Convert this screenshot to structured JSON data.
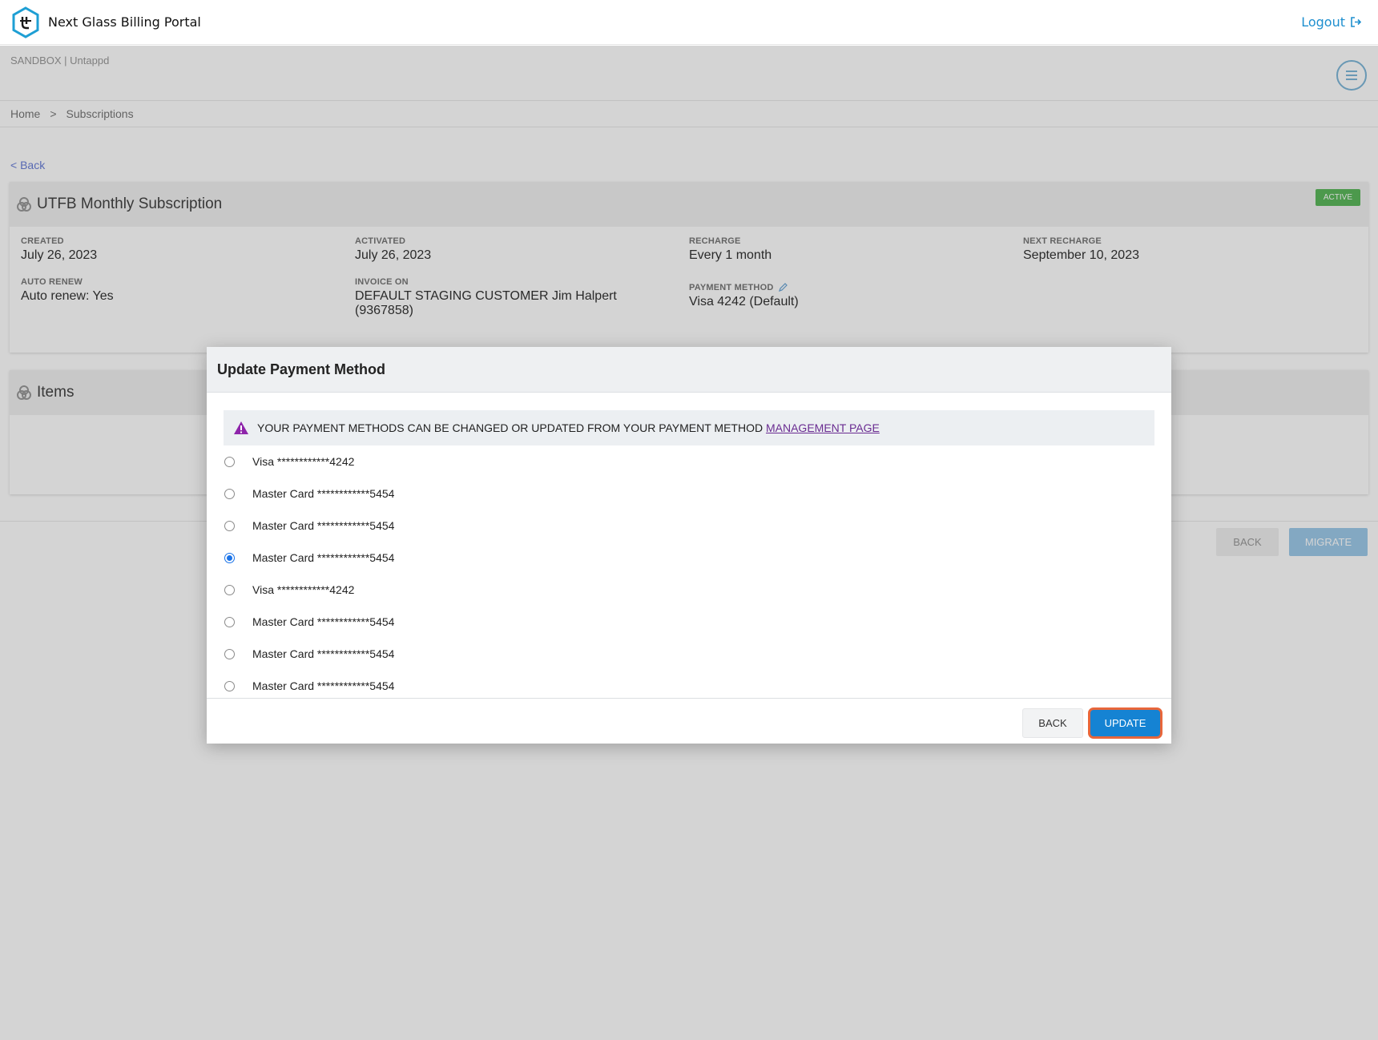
{
  "header": {
    "app_title": "Next Glass Billing Portal",
    "logout_label": "Logout"
  },
  "page": {
    "env_label": "SANDBOX | Untappd",
    "breadcrumb": [
      "Home",
      ">",
      "Subscriptions"
    ],
    "back_link": "< Back",
    "subscription": {
      "title": "UTFB Monthly Subscription",
      "status": "ACTIVE",
      "fields": {
        "created_label": "CREATED",
        "created_value": "July 26, 2023",
        "activated_label": "ACTIVATED",
        "activated_value": "July 26, 2023",
        "recharge_label": "RECHARGE",
        "recharge_value": "Every 1 month",
        "next_recharge_label": "NEXT RECHARGE",
        "next_recharge_value": "September 10, 2023",
        "auto_renew_label": "AUTO RENEW",
        "auto_renew_value": "Auto renew: Yes",
        "invoice_on_label": "INVOICE ON",
        "invoice_on_value": "DEFAULT STAGING CUSTOMER Jim Halpert (9367858)",
        "payment_method_label": "PAYMENT METHOD",
        "payment_method_value": "Visa 4242 (Default)"
      }
    },
    "items_title": "Items",
    "buttons": {
      "back": "BACK",
      "migrate": "MIGRATE"
    }
  },
  "modal": {
    "title": "Update Payment Method",
    "notice_text": "YOUR PAYMENT METHODS CAN BE CHANGED OR UPDATED FROM YOUR PAYMENT METHOD",
    "notice_link": "MANAGEMENT PAGE",
    "options": [
      {
        "label": "Visa ************4242",
        "checked": false
      },
      {
        "label": "Master Card ************5454",
        "checked": false
      },
      {
        "label": "Master Card ************5454",
        "checked": false
      },
      {
        "label": "Master Card ************5454",
        "checked": true
      },
      {
        "label": "Visa ************4242",
        "checked": false
      },
      {
        "label": "Master Card ************5454",
        "checked": false
      },
      {
        "label": "Master Card ************5454",
        "checked": false
      },
      {
        "label": "Master Card ************5454",
        "checked": false
      }
    ],
    "back_label": "BACK",
    "update_label": "UPDATE"
  },
  "colors": {
    "accent": "#1583d3",
    "focus_ring": "#e8663a",
    "warning_icon": "#8e24aa",
    "active_badge": "#5cb85c"
  }
}
